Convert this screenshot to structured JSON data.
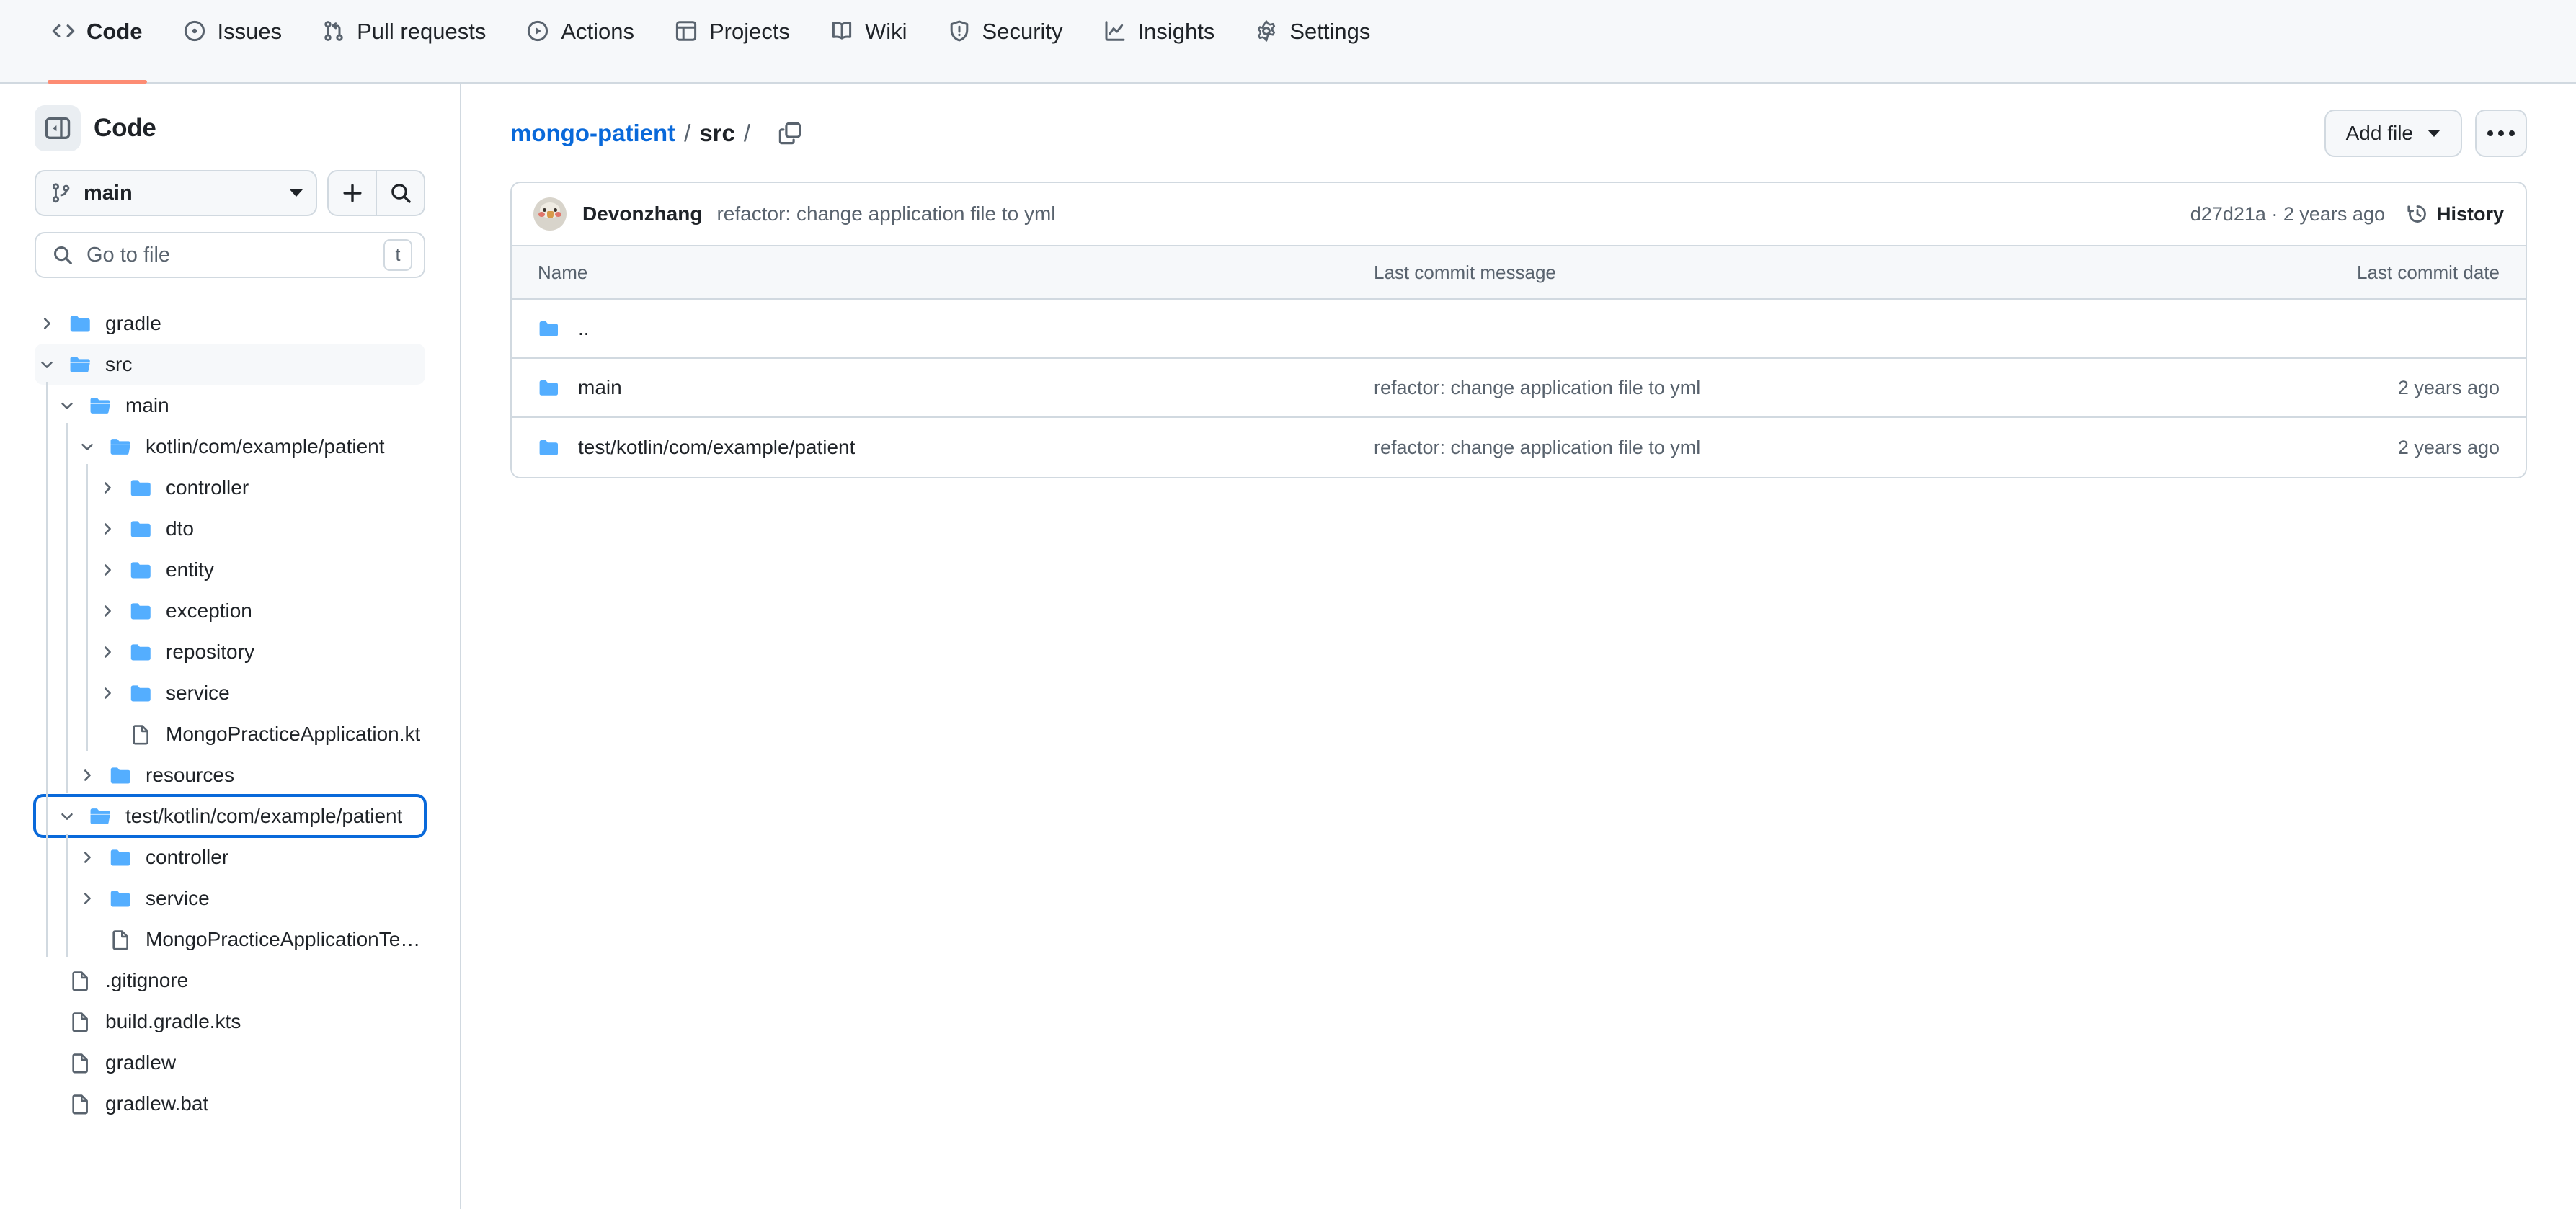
{
  "nav": {
    "tabs": [
      {
        "label": "Code",
        "icon": "code-icon",
        "active": true
      },
      {
        "label": "Issues",
        "icon": "issue-opened-icon",
        "active": false
      },
      {
        "label": "Pull requests",
        "icon": "git-pull-request-icon",
        "active": false
      },
      {
        "label": "Actions",
        "icon": "play-icon",
        "active": false
      },
      {
        "label": "Projects",
        "icon": "table-icon",
        "active": false
      },
      {
        "label": "Wiki",
        "icon": "book-icon",
        "active": false
      },
      {
        "label": "Security",
        "icon": "shield-icon",
        "active": false
      },
      {
        "label": "Insights",
        "icon": "graph-icon",
        "active": false
      },
      {
        "label": "Settings",
        "icon": "gear-icon",
        "active": false
      }
    ]
  },
  "sidebar": {
    "title": "Code",
    "panel_toggle_icon": "sidebar-collapse-icon",
    "branch": {
      "name": "main",
      "icon": "git-branch-icon"
    },
    "add_button_icon": "plus-icon",
    "search_button_icon": "search-icon",
    "go_to_file": {
      "placeholder": "Go to file",
      "value": "",
      "icon": "search-icon",
      "shortcut": "t"
    },
    "tree": [
      {
        "label": "gradle",
        "type": "folder",
        "depth": 0,
        "state": "collapsed",
        "selected": false,
        "focused": false
      },
      {
        "label": "src",
        "type": "folder",
        "depth": 0,
        "state": "expanded",
        "selected": true,
        "focused": false
      },
      {
        "label": "main",
        "type": "folder",
        "depth": 1,
        "state": "expanded",
        "selected": false,
        "focused": false
      },
      {
        "label": "kotlin/com/example/patient",
        "type": "folder",
        "depth": 2,
        "state": "expanded",
        "selected": false,
        "focused": false
      },
      {
        "label": "controller",
        "type": "folder",
        "depth": 3,
        "state": "collapsed",
        "selected": false,
        "focused": false
      },
      {
        "label": "dto",
        "type": "folder",
        "depth": 3,
        "state": "collapsed",
        "selected": false,
        "focused": false
      },
      {
        "label": "entity",
        "type": "folder",
        "depth": 3,
        "state": "collapsed",
        "selected": false,
        "focused": false
      },
      {
        "label": "exception",
        "type": "folder",
        "depth": 3,
        "state": "collapsed",
        "selected": false,
        "focused": false
      },
      {
        "label": "repository",
        "type": "folder",
        "depth": 3,
        "state": "collapsed",
        "selected": false,
        "focused": false
      },
      {
        "label": "service",
        "type": "folder",
        "depth": 3,
        "state": "collapsed",
        "selected": false,
        "focused": false
      },
      {
        "label": "MongoPracticeApplication.kt",
        "type": "file",
        "depth": 3,
        "state": "leaf",
        "selected": false,
        "focused": false
      },
      {
        "label": "resources",
        "type": "folder",
        "depth": 2,
        "state": "collapsed",
        "selected": false,
        "focused": false
      },
      {
        "label": "test/kotlin/com/example/patient",
        "type": "folder",
        "depth": 1,
        "state": "expanded",
        "selected": false,
        "focused": true
      },
      {
        "label": "controller",
        "type": "folder",
        "depth": 2,
        "state": "collapsed",
        "selected": false,
        "focused": false
      },
      {
        "label": "service",
        "type": "folder",
        "depth": 2,
        "state": "collapsed",
        "selected": false,
        "focused": false
      },
      {
        "label": "MongoPracticeApplicationTe…",
        "type": "file",
        "depth": 2,
        "state": "leaf",
        "selected": false,
        "focused": false
      },
      {
        "label": ".gitignore",
        "type": "file",
        "depth": 0,
        "state": "leaf",
        "selected": false,
        "focused": false
      },
      {
        "label": "build.gradle.kts",
        "type": "file",
        "depth": 0,
        "state": "leaf",
        "selected": false,
        "focused": false
      },
      {
        "label": "gradlew",
        "type": "file",
        "depth": 0,
        "state": "leaf",
        "selected": false,
        "focused": false
      },
      {
        "label": "gradlew.bat",
        "type": "file",
        "depth": 0,
        "state": "leaf",
        "selected": false,
        "focused": false
      }
    ]
  },
  "main": {
    "breadcrumb": {
      "repo": "mongo-patient",
      "separator": "/",
      "current": "src",
      "trailing_separator": "/",
      "copy_icon": "copy-path-icon"
    },
    "actions": {
      "add_file_label": "Add file",
      "more_options_icon": "kebab-horizontal-icon"
    },
    "commit": {
      "author": "Devonzhang",
      "message": "refactor: change application file to yml",
      "meta": "d27d21a · 2 years ago",
      "history_label": "History",
      "history_icon": "history-icon"
    },
    "table": {
      "headers": {
        "name": "Name",
        "message": "Last commit message",
        "date": "Last commit date"
      },
      "rows": [
        {
          "name": "..",
          "icon": "folder-icon",
          "message": "",
          "date": ""
        },
        {
          "name": "main",
          "icon": "folder-icon",
          "message": "refactor: change application file to yml",
          "date": "2 years ago"
        },
        {
          "name": "test/kotlin/com/example/patient",
          "icon": "folder-icon",
          "message": "refactor: change application file to yml",
          "date": "2 years ago"
        }
      ]
    }
  },
  "colors": {
    "accent": "#0969da",
    "active_tab_underline": "#fd8c73",
    "folder_blue": "#54aeff",
    "border": "#d1d9e0",
    "muted_text": "#59636e",
    "surface": "#f6f8fa"
  }
}
